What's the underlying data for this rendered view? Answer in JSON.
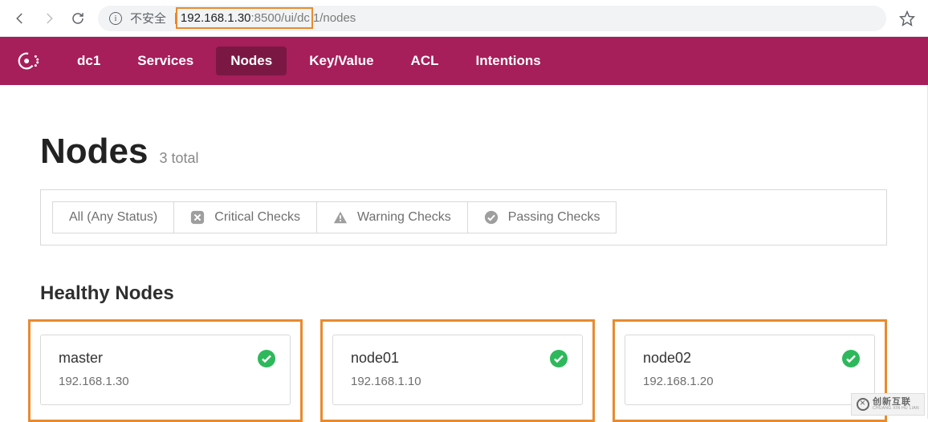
{
  "browser": {
    "insecure_label": "不安全",
    "url_host": "192.168.1.30",
    "url_port": ":8500",
    "url_path_in": "/ui/dc",
    "url_path_rest": "1/nodes"
  },
  "nav": {
    "dc": "dc1",
    "services": "Services",
    "nodes": "Nodes",
    "kv": "Key/Value",
    "acl": "ACL",
    "intentions": "Intentions"
  },
  "page": {
    "title": "Nodes",
    "count_label": "3 total"
  },
  "filters": {
    "all": "All (Any Status)",
    "critical": "Critical Checks",
    "warning": "Warning Checks",
    "passing": "Passing Checks"
  },
  "section": {
    "healthy_title": "Healthy Nodes"
  },
  "nodes": [
    {
      "name": "master",
      "ip": "192.168.1.30"
    },
    {
      "name": "node01",
      "ip": "192.168.1.10"
    },
    {
      "name": "node02",
      "ip": "192.168.1.20"
    }
  ],
  "watermark": {
    "line1": "创新互联",
    "line2": "CHUANG XIN HU LIAN"
  }
}
